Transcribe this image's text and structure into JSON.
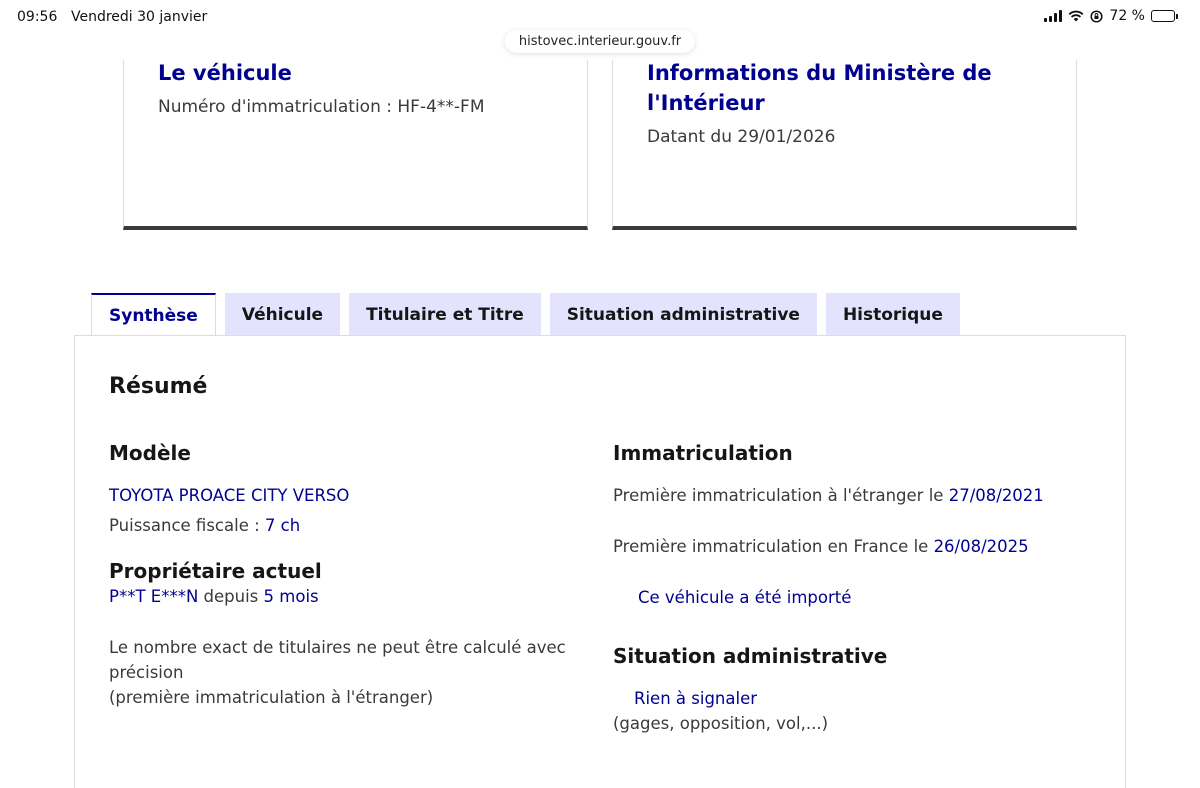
{
  "status_bar": {
    "time": "09:56",
    "date": "Vendredi 30 janvier",
    "battery": "72 %"
  },
  "browser": {
    "url": "histovec.interieur.gouv.fr"
  },
  "cards": {
    "vehicle": {
      "title": "Le véhicule",
      "registration": "Numéro d'immatriculation : HF-4**-FM"
    },
    "ministry": {
      "title_line1": "Informations du Ministère de",
      "title_line2": "l'Intérieur",
      "date": "Datant du 29/01/2026"
    }
  },
  "tabs": [
    {
      "label": "Synthèse"
    },
    {
      "label": "Véhicule"
    },
    {
      "label": "Titulaire et Titre"
    },
    {
      "label": "Situation administrative"
    },
    {
      "label": "Historique"
    }
  ],
  "summary": {
    "title": "Résumé",
    "model": {
      "title": "Modèle",
      "name": "TOYOTA PROACE CITY VERSO",
      "fiscal_label": "Puissance fiscale : ",
      "fiscal_value": "7 ch"
    },
    "owner": {
      "title": "Propriétaire actuel",
      "name": "P**T E***N",
      "since_label": " depuis ",
      "since_value": "5 mois",
      "note_line1": "Le nombre exact de titulaires ne peut être calculé avec",
      "note_line2": "précision",
      "note_line3": "(première immatriculation à l'étranger)"
    },
    "registration": {
      "title": "Immatriculation",
      "foreign_label": "Première immatriculation à l'étranger le ",
      "foreign_date": "27/08/2021",
      "france_label": "Première immatriculation en France le ",
      "france_date": "26/08/2025",
      "imported": "Ce véhicule a été importé"
    },
    "admin": {
      "title": "Situation administrative",
      "status": "Rien à signaler",
      "details": "(gages, opposition, vol,...)"
    }
  }
}
